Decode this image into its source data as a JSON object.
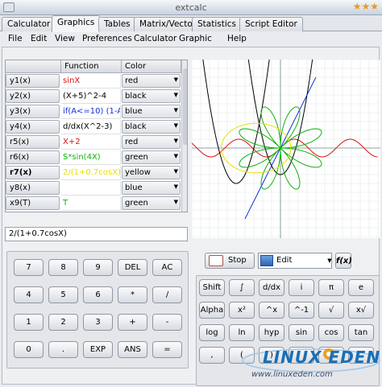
{
  "window": {
    "title": "extcalc"
  },
  "tabs": [
    "Calculator",
    "Graphics",
    "Tables",
    "Matrix/Vector",
    "Statistics",
    "Script Editor"
  ],
  "active_tab": "Graphics",
  "menu": [
    "File",
    "Edit",
    "View",
    "Preferences",
    "Calculator",
    "Graphic",
    "Help"
  ],
  "table": {
    "headers": {
      "function": "Function",
      "color": "Color"
    },
    "rows": [
      {
        "label": "y1(x)",
        "func": "sinX",
        "func_color": "#e01010",
        "color": "red"
      },
      {
        "label": "y2(x)",
        "func": "(X+5)^2-4",
        "func_color": "#000000",
        "color": "black"
      },
      {
        "label": "y3(x)",
        "func": "if(A<=10) (1-A/",
        "func_color": "#1030e0",
        "color": "blue"
      },
      {
        "label": "y4(x)",
        "func": "d/dx(X^2-3)",
        "func_color": "#000000",
        "color": "black"
      },
      {
        "label": "r5(x)",
        "func": "X+2",
        "func_color": "#e01010",
        "color": "red"
      },
      {
        "label": "r6(x)",
        "func": "S*sin(4X)",
        "func_color": "#10b010",
        "color": "green"
      },
      {
        "label": "r7(x)",
        "func": "2/(1+0.7cosX)",
        "func_color": "#e8e000",
        "color": "yellow"
      },
      {
        "label": "y8(x)",
        "func": "",
        "func_color": "#000000",
        "color": "blue"
      },
      {
        "label": "x9(T)",
        "func": "T",
        "func_color": "#10b010",
        "color": "green"
      }
    ]
  },
  "expression": "2/(1+0.7cosX)",
  "numpad": [
    [
      "7",
      "8",
      "9",
      "DEL",
      "AC"
    ],
    [
      "4",
      "5",
      "6",
      "*",
      "/"
    ],
    [
      "1",
      "2",
      "3",
      "+",
      "-"
    ],
    [
      "0",
      ".",
      "EXP",
      "ANS",
      "="
    ]
  ],
  "graph_controls": {
    "stop": "Stop",
    "edit": "Edit",
    "fx": "f(x)"
  },
  "funcpad": [
    [
      "Shift",
      "∫",
      "d/dx",
      "i",
      "π",
      "e"
    ],
    [
      "Alpha",
      "x²",
      "^x",
      "^-1",
      "√",
      "x√"
    ],
    [
      "log",
      "ln",
      "hyp",
      "sin",
      "cos",
      "tan"
    ],
    [
      ",",
      "(",
      ")",
      "",
      "",
      ""
    ]
  ],
  "watermark": {
    "brand": "LINUX EDEN",
    "url": "www.linuxeden.com"
  },
  "colors": {
    "accent": "#1a6fb5",
    "star": "#e79a1f"
  }
}
